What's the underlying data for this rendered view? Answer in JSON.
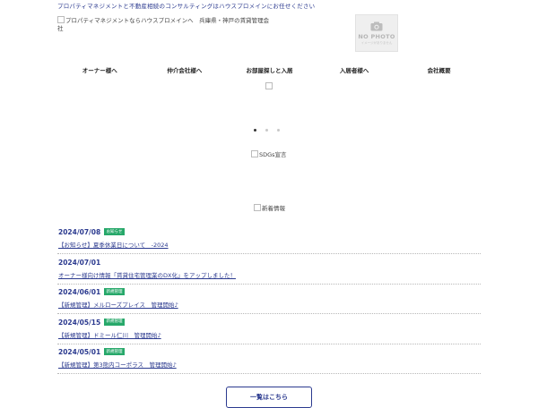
{
  "header": {
    "tagline": "プロパティマネジメントと不動産相続のコンサルティングはハウスプロメインにお任せください",
    "logo_alt": "プロパティマネジメントならハウスプロメインへ　兵庫県・神戸の賃貸管理会社",
    "no_photo": {
      "line1": "NO PHOTO",
      "line2": "イメージがありません"
    }
  },
  "gnav": [
    "オーナー様へ",
    "仲介会社様へ",
    "お部屋探しと入居",
    "入居者様へ",
    "会社概要"
  ],
  "slider": {
    "dot_count": 3,
    "active_index": 0
  },
  "sdgs_alt": "SDGs宣言",
  "news": {
    "heading_alt": "新着情報",
    "items": [
      {
        "date": "2024/07/08",
        "tag": "お知らせ",
        "title": "【お知らせ】夏季休業日について　-2024"
      },
      {
        "date": "2024/07/01",
        "tag": "",
        "title": "オーナー様向け情報「賃貸住宅管理業のDX化」をアップしました！"
      },
      {
        "date": "2024/06/01",
        "tag": "新規管理",
        "title": "【新規管理】メルローズプレイス　管理開始♪"
      },
      {
        "date": "2024/05/15",
        "tag": "新規管理",
        "title": "【新規管理】ドミール仁川　管理開始♪"
      },
      {
        "date": "2024/05/01",
        "tag": "新規管理",
        "title": "【新規管理】第3熊内コーポラス　管理開始♪"
      }
    ],
    "more_label": "一覧はこちら"
  }
}
